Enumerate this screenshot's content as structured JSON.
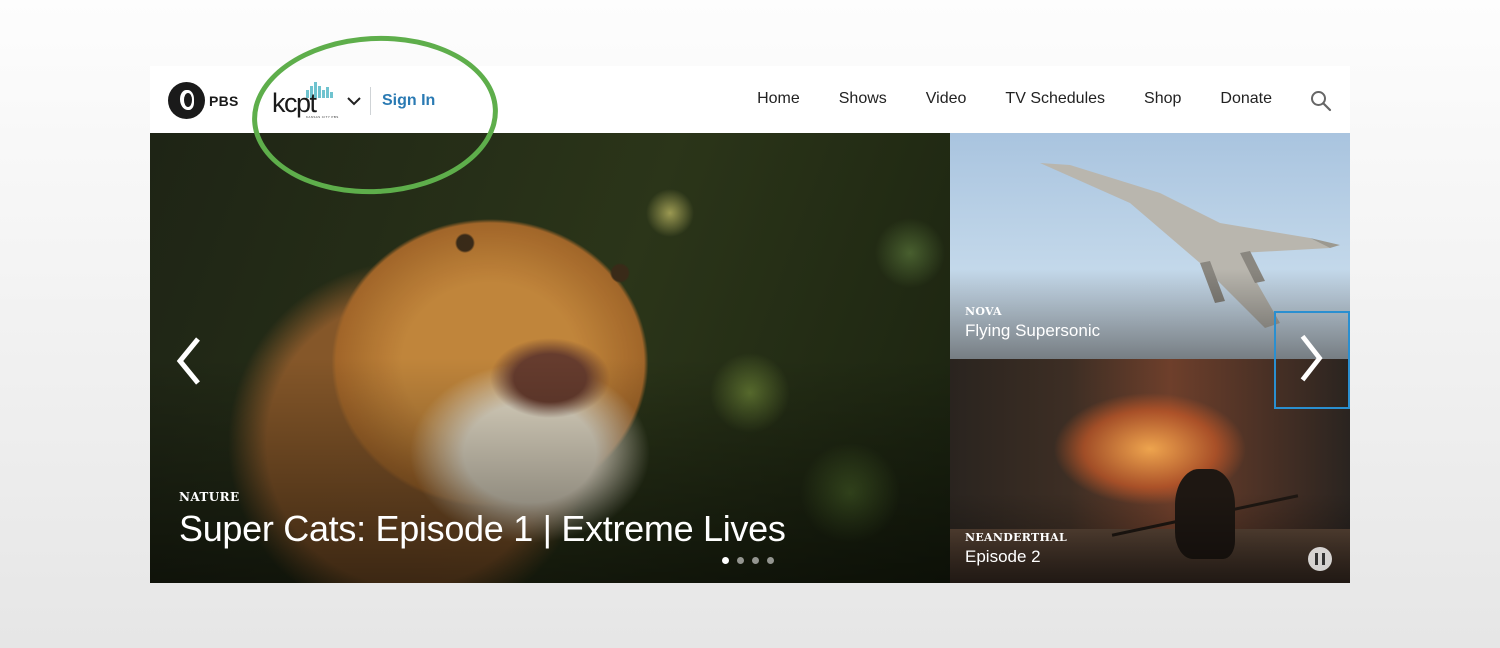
{
  "header": {
    "brand": "PBS",
    "station_logo": "kcpt",
    "station_logo_subtext": "KANSAS CITY PBS",
    "sign_in_label": "Sign In"
  },
  "nav": {
    "items": [
      {
        "label": "Home"
      },
      {
        "label": "Shows"
      },
      {
        "label": "Video"
      },
      {
        "label": "TV Schedules"
      },
      {
        "label": "Shop"
      },
      {
        "label": "Donate"
      }
    ],
    "search_icon": "search-icon"
  },
  "hero": {
    "show": "NATURE",
    "title": "Super Cats: Episode 1 | Extreme Lives",
    "slide_count": 4,
    "active_slide": 1
  },
  "tiles": [
    {
      "show": "NOVA",
      "title": "Flying Supersonic"
    },
    {
      "show": "NEANDERTHAL",
      "title": "Episode 2"
    }
  ],
  "colors": {
    "link_blue": "#2a7ab3",
    "annotation_green": "#5eae4b",
    "focus_blue": "#2a8fd0",
    "logo_teal": "#6fc3cf"
  }
}
